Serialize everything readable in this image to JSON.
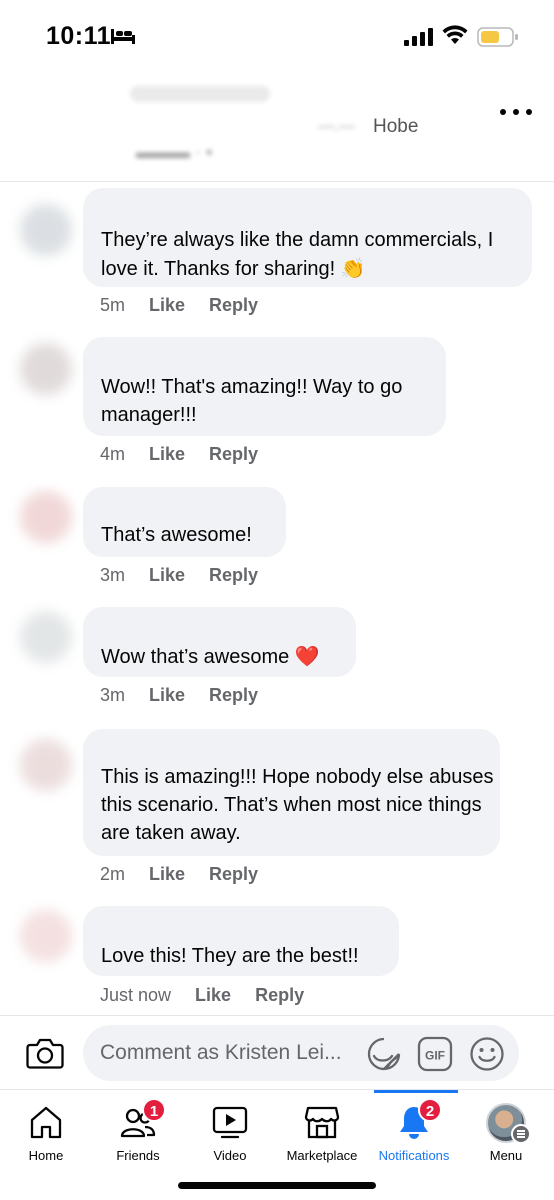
{
  "status_bar": {
    "time": "10:11"
  },
  "post_header": {
    "visible_text": "Hobe"
  },
  "comments": [
    {
      "text": "They’re always like the damn commercials, I love it. Thanks for sharing!",
      "emoji": "👏",
      "time": "5m",
      "like": "Like",
      "reply": "Reply"
    },
    {
      "text": "Wow!! That's amazing!! Way to go manager!!!",
      "emoji": "",
      "time": "4m",
      "like": "Like",
      "reply": "Reply"
    },
    {
      "text": "That’s awesome!",
      "emoji": "",
      "time": "3m",
      "like": "Like",
      "reply": "Reply"
    },
    {
      "text": "Wow that’s awesome",
      "emoji": "❤️",
      "time": "3m",
      "like": "Like",
      "reply": "Reply"
    },
    {
      "text": "This is amazing!!! Hope nobody else abuses this scenario. That’s when most nice things are taken away.",
      "emoji": "",
      "time": "2m",
      "like": "Like",
      "reply": "Reply"
    },
    {
      "text": "Love this! They are the best!!",
      "emoji": "",
      "time": "Just now",
      "like": "Like",
      "reply": "Reply"
    }
  ],
  "composer": {
    "placeholder": "Comment as Kristen Lei...",
    "gif_label": "GIF"
  },
  "bottom_nav": {
    "items": [
      {
        "label": "Home",
        "icon": "home-icon"
      },
      {
        "label": "Friends",
        "icon": "friends-icon",
        "badge": "1"
      },
      {
        "label": "Video",
        "icon": "video-icon"
      },
      {
        "label": "Marketplace",
        "icon": "marketplace-icon"
      },
      {
        "label": "Notifications",
        "icon": "bell-icon",
        "badge": "2",
        "active": true
      },
      {
        "label": "Menu",
        "icon": "profile-avatar"
      }
    ]
  },
  "colors": {
    "accent": "#1877f2",
    "badge": "#e41e3f",
    "bubble": "#f0f2f5",
    "secondary_text": "#65676b"
  }
}
